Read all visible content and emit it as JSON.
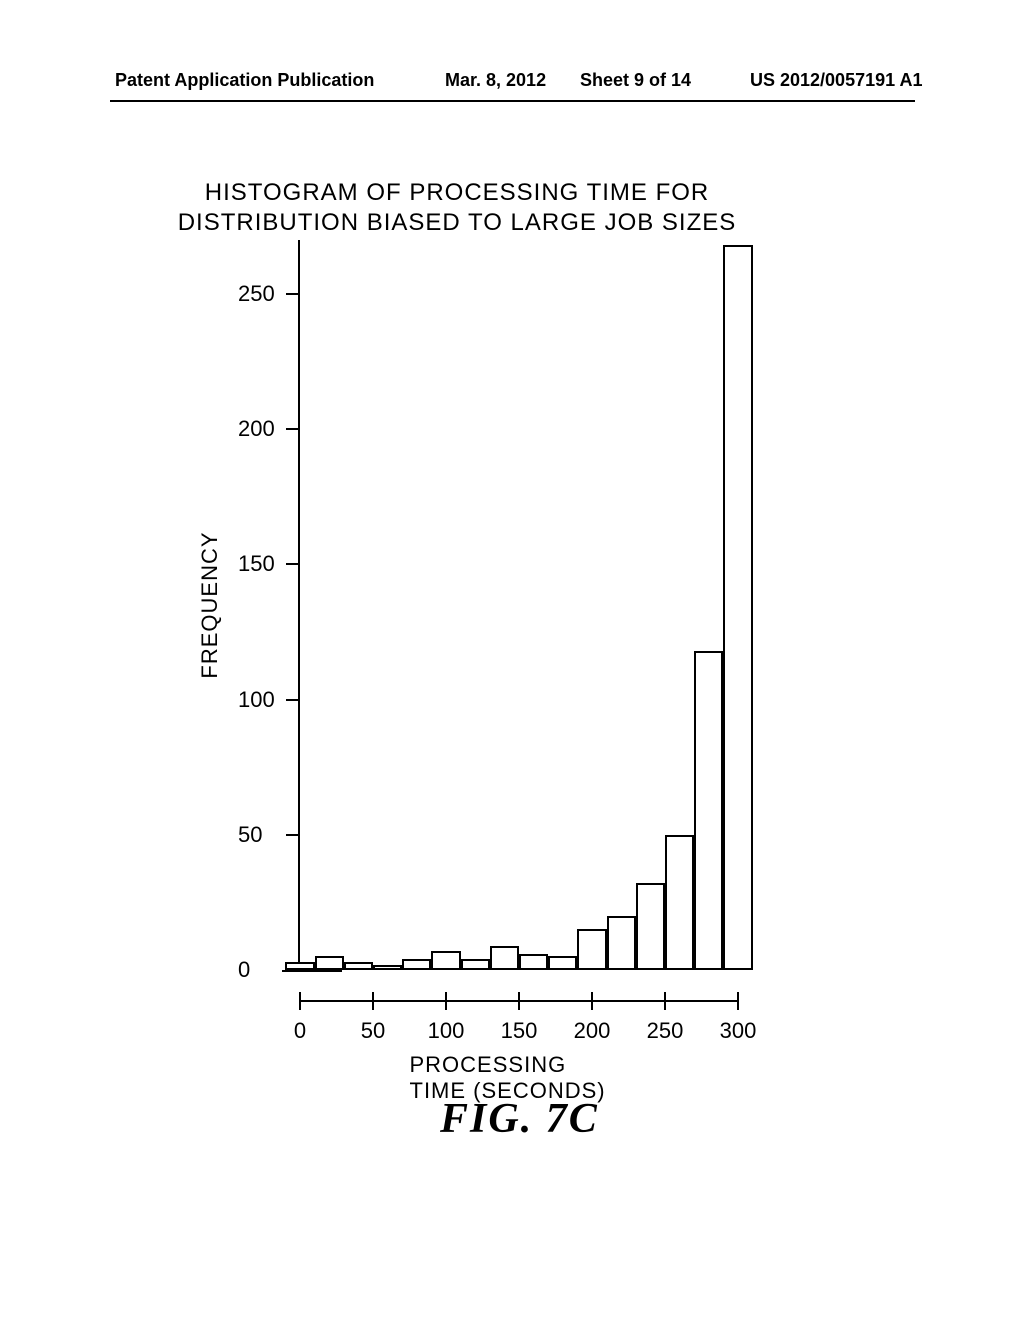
{
  "header": {
    "left": "Patent Application Publication",
    "date": "Mar. 8, 2012",
    "sheet": "Sheet 9 of 14",
    "pubno": "US 2012/0057191 A1"
  },
  "figure_label": "FIG. 7C",
  "chart_data": {
    "type": "bar",
    "title_line1": "HISTOGRAM OF PROCESSING TIME FOR",
    "title_line2": "DISTRIBUTION BIASED TO LARGE  JOB SIZES",
    "xlabel": "PROCESSING TIME (SECONDS)",
    "ylabel": "FREQUENCY",
    "x_ticks": [
      0,
      50,
      100,
      150,
      200,
      250,
      300
    ],
    "y_ticks": [
      0,
      50,
      100,
      150,
      200,
      250
    ],
    "xlim": [
      0,
      300
    ],
    "ylim": [
      0,
      270
    ],
    "bin_width": 20,
    "categories": [
      0,
      20,
      40,
      60,
      80,
      100,
      120,
      140,
      160,
      180,
      200,
      220,
      240,
      260,
      280
    ],
    "values": [
      3,
      5,
      3,
      2,
      4,
      7,
      4,
      9,
      6,
      5,
      15,
      20,
      32,
      50,
      118,
      268
    ]
  }
}
